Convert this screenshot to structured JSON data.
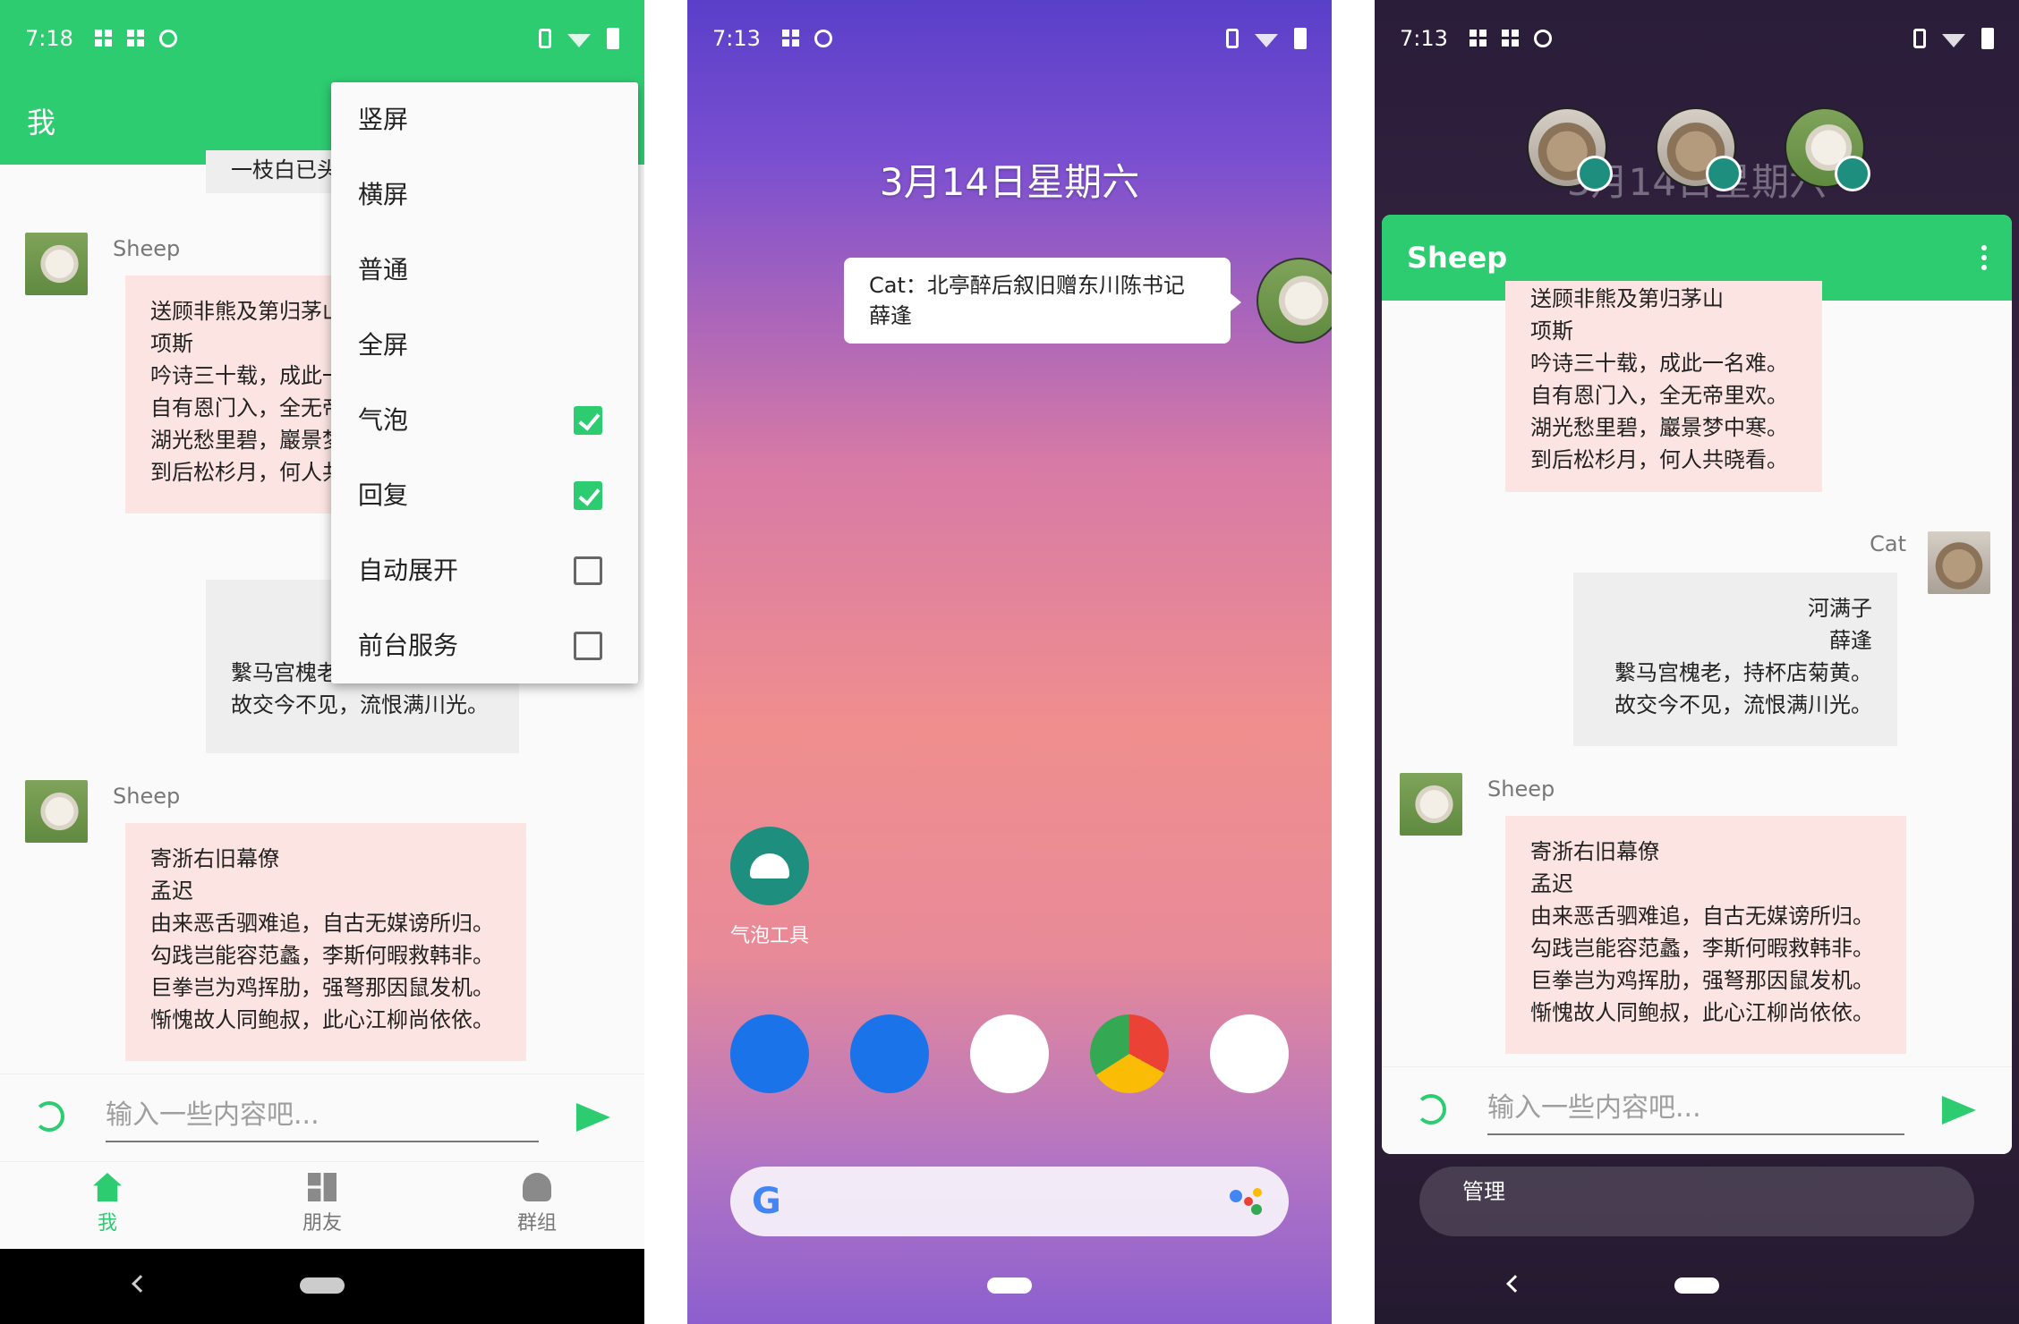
{
  "panel1": {
    "status_time": "7:18",
    "title": "我",
    "partial_top_bubble": "一枝白已头",
    "messages": [
      {
        "user": "Sheep",
        "text": "送顾非熊及第归茅山\n项斯\n吟诗三十载，成此一\n自有恩门入，全无帝\n湖光愁里碧，巖景梦\n到后松杉月，何人共"
      },
      {
        "text": "繫马宫槐老，持杯店菊黄。\n故交今不见，流恨满川光。"
      },
      {
        "user": "Sheep",
        "text": "寄浙右旧幕僚\n孟迟\n由来恶舌驷难追，自古无媒谤所归。\n勾践岂能容范蠡，李斯何暇救韩非。\n巨拳岂为鸡挥肋，强弩那因鼠发机。\n惭愧故人同鲍叔，此心江柳尚依依。"
      }
    ],
    "input_placeholder": "输入一些内容吧...",
    "nav": [
      {
        "label": "我"
      },
      {
        "label": "朋友"
      },
      {
        "label": "群组"
      }
    ],
    "menu": [
      {
        "label": "竖屏"
      },
      {
        "label": "横屏"
      },
      {
        "label": "普通"
      },
      {
        "label": "全屏"
      },
      {
        "label": "气泡",
        "checked": true
      },
      {
        "label": "回复",
        "checked": true
      },
      {
        "label": "自动展开",
        "checked": false
      },
      {
        "label": "前台服务",
        "checked": false
      }
    ]
  },
  "panel2": {
    "status_time": "7:13",
    "date": "3月14日星期六",
    "notification": "Cat：北亭醉后叙旧赠东川陈书记\n薛逢",
    "app_label": "气泡工具",
    "dock_icons": [
      "phone-icon",
      "messages-icon",
      "play-store-icon",
      "chrome-icon",
      "camera-icon"
    ],
    "search_logo": "G"
  },
  "panel3": {
    "status_time": "7:13",
    "behind_date": "3月14日星期六",
    "title": "Sheep",
    "messages": [
      {
        "text": "送顾非熊及第归茅山\n项斯\n吟诗三十载，成此一名难。\n自有恩门入，全无帝里欢。\n湖光愁里碧，巖景梦中寒。\n到后松杉月，何人共晓看。"
      },
      {
        "user": "Cat",
        "text": "河满子\n薛逢\n繫马宫槐老，持杯店菊黄。\n故交今不见，流恨满川光。"
      },
      {
        "user": "Sheep",
        "text": "寄浙右旧幕僚\n孟迟\n由来恶舌驷难追，自古无媒谤所归。\n勾践岂能容范蠡，李斯何暇救韩非。\n巨拳岂为鸡挥肋，强弩那因鼠发机。\n惭愧故人同鲍叔，此心江柳尚依依。"
      }
    ],
    "input_placeholder": "输入一些内容吧...",
    "manage_label": "管理"
  },
  "colors": {
    "accent": "#2ecc71",
    "bubble_pink": "#fce4e2",
    "bubble_grey": "#eeeeee"
  }
}
